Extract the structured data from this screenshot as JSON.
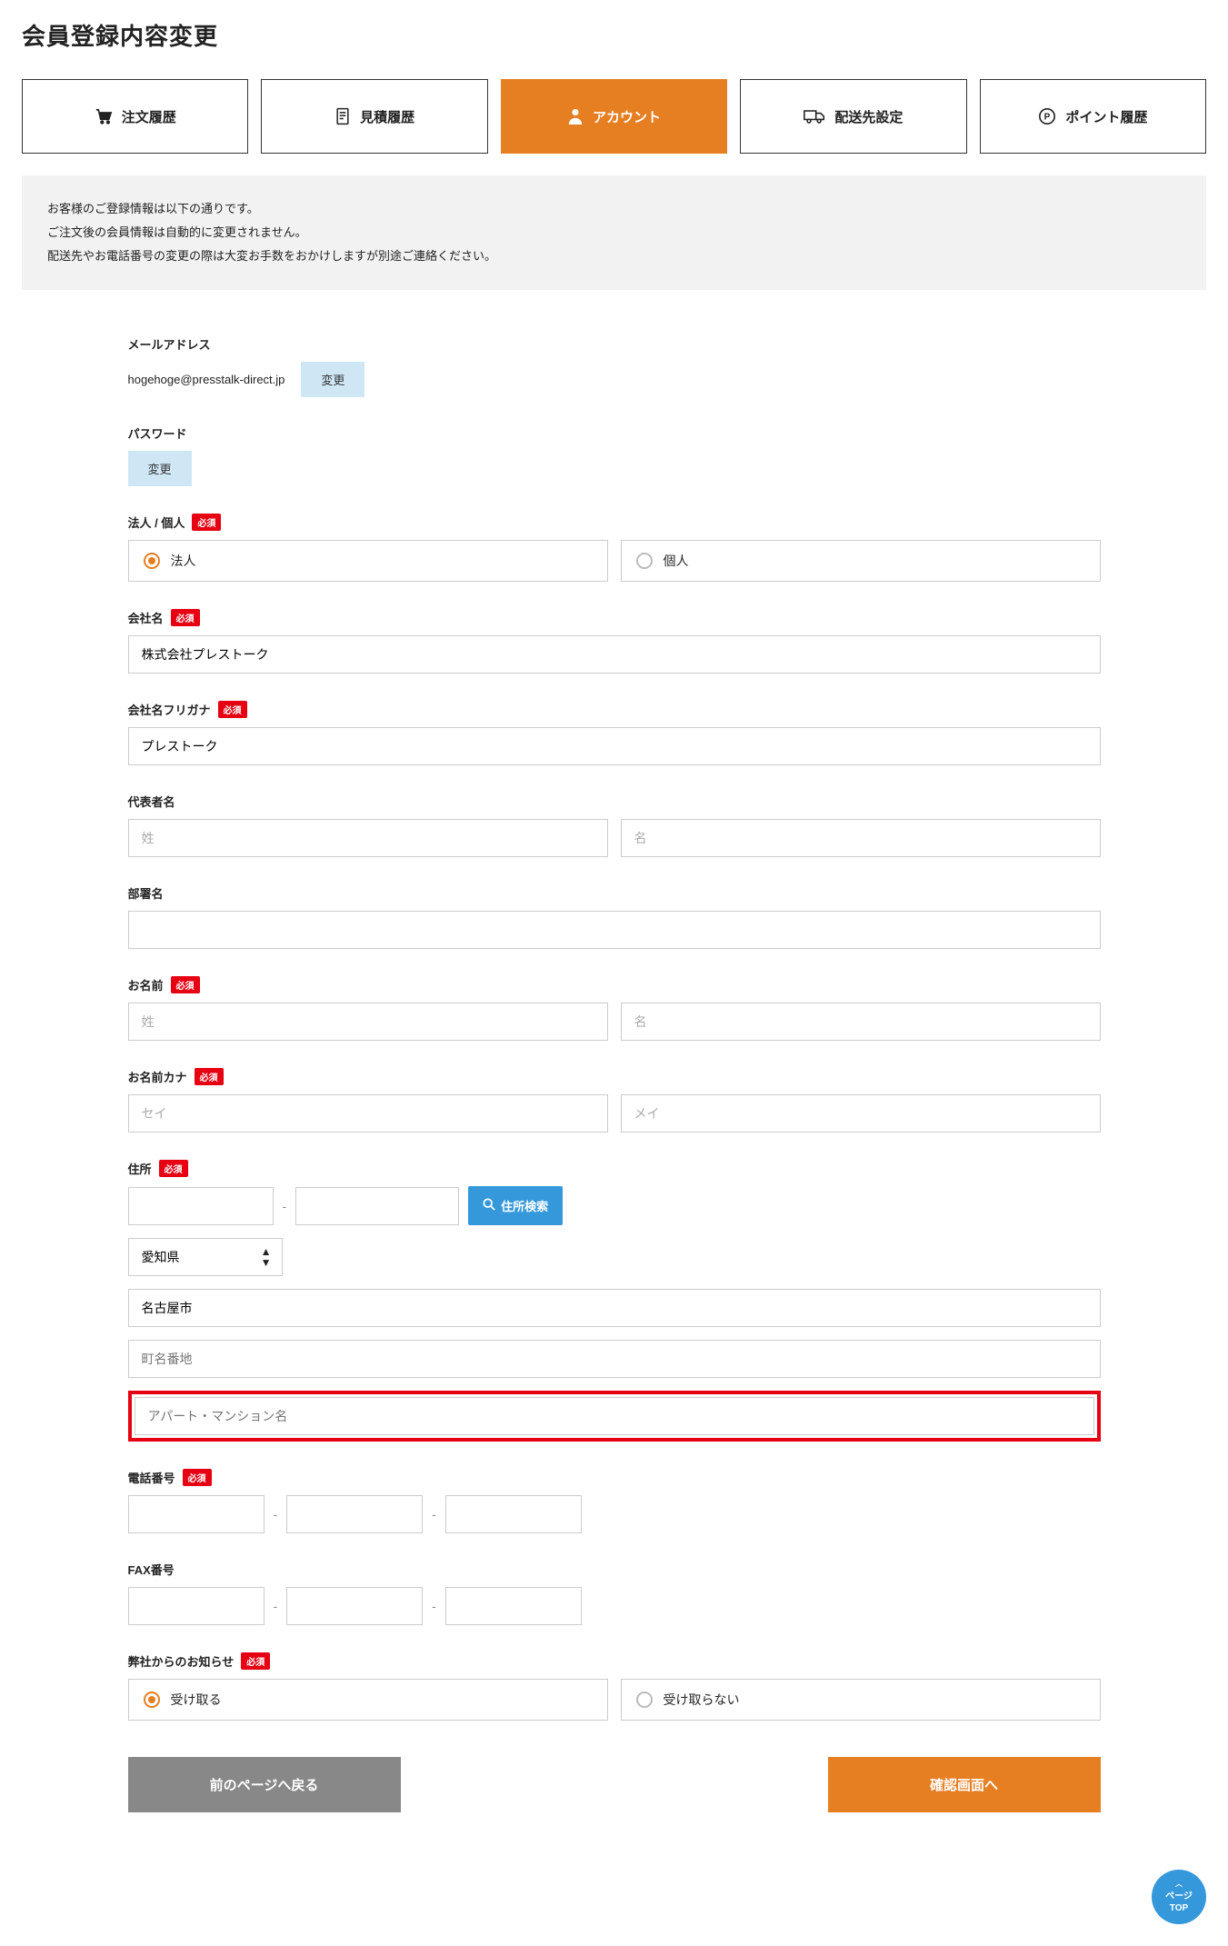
{
  "page_title": "会員登録内容変更",
  "tabs": {
    "order_history": "注文履歴",
    "estimate_history": "見積履歴",
    "account": "アカウント",
    "shipping": "配送先設定",
    "points": "ポイント履歴"
  },
  "notice": {
    "line1": "お客様のご登録情報は以下の通りです。",
    "line2": "ご注文後の会員情報は自動的に変更されません。",
    "line3": "配送先やお電話番号の変更の際は大変お手数をおかけしますが別途ご連絡ください。"
  },
  "labels": {
    "email": "メールアドレス",
    "password": "パスワード",
    "entity_type": "法人 / 個人",
    "company_name": "会社名",
    "company_kana": "会社名フリガナ",
    "representative": "代表者名",
    "department": "部署名",
    "name": "お名前",
    "name_kana": "お名前カナ",
    "address": "住所",
    "phone": "電話番号",
    "fax": "FAX番号",
    "newsletter": "弊社からのお知らせ",
    "required": "必須"
  },
  "values": {
    "email": "hogehoge@presstalk-direct.jp",
    "company_name": "株式会社プレストーク",
    "company_kana": "プレストーク",
    "prefecture": "愛知県",
    "city": "名古屋市"
  },
  "options": {
    "entity_corporate": "法人",
    "entity_individual": "個人",
    "newsletter_yes": "受け取る",
    "newsletter_no": "受け取らない"
  },
  "placeholders": {
    "lastname": "姓",
    "firstname": "名",
    "lastname_kana": "セイ",
    "firstname_kana": "メイ",
    "street": "町名番地",
    "building": "アパート・マンション名"
  },
  "buttons": {
    "change": "変更",
    "postal_search": "住所検索",
    "back": "前のページへ戻る",
    "confirm": "確認画面へ"
  },
  "page_top": {
    "line1": "ページ",
    "line2": "TOP"
  }
}
